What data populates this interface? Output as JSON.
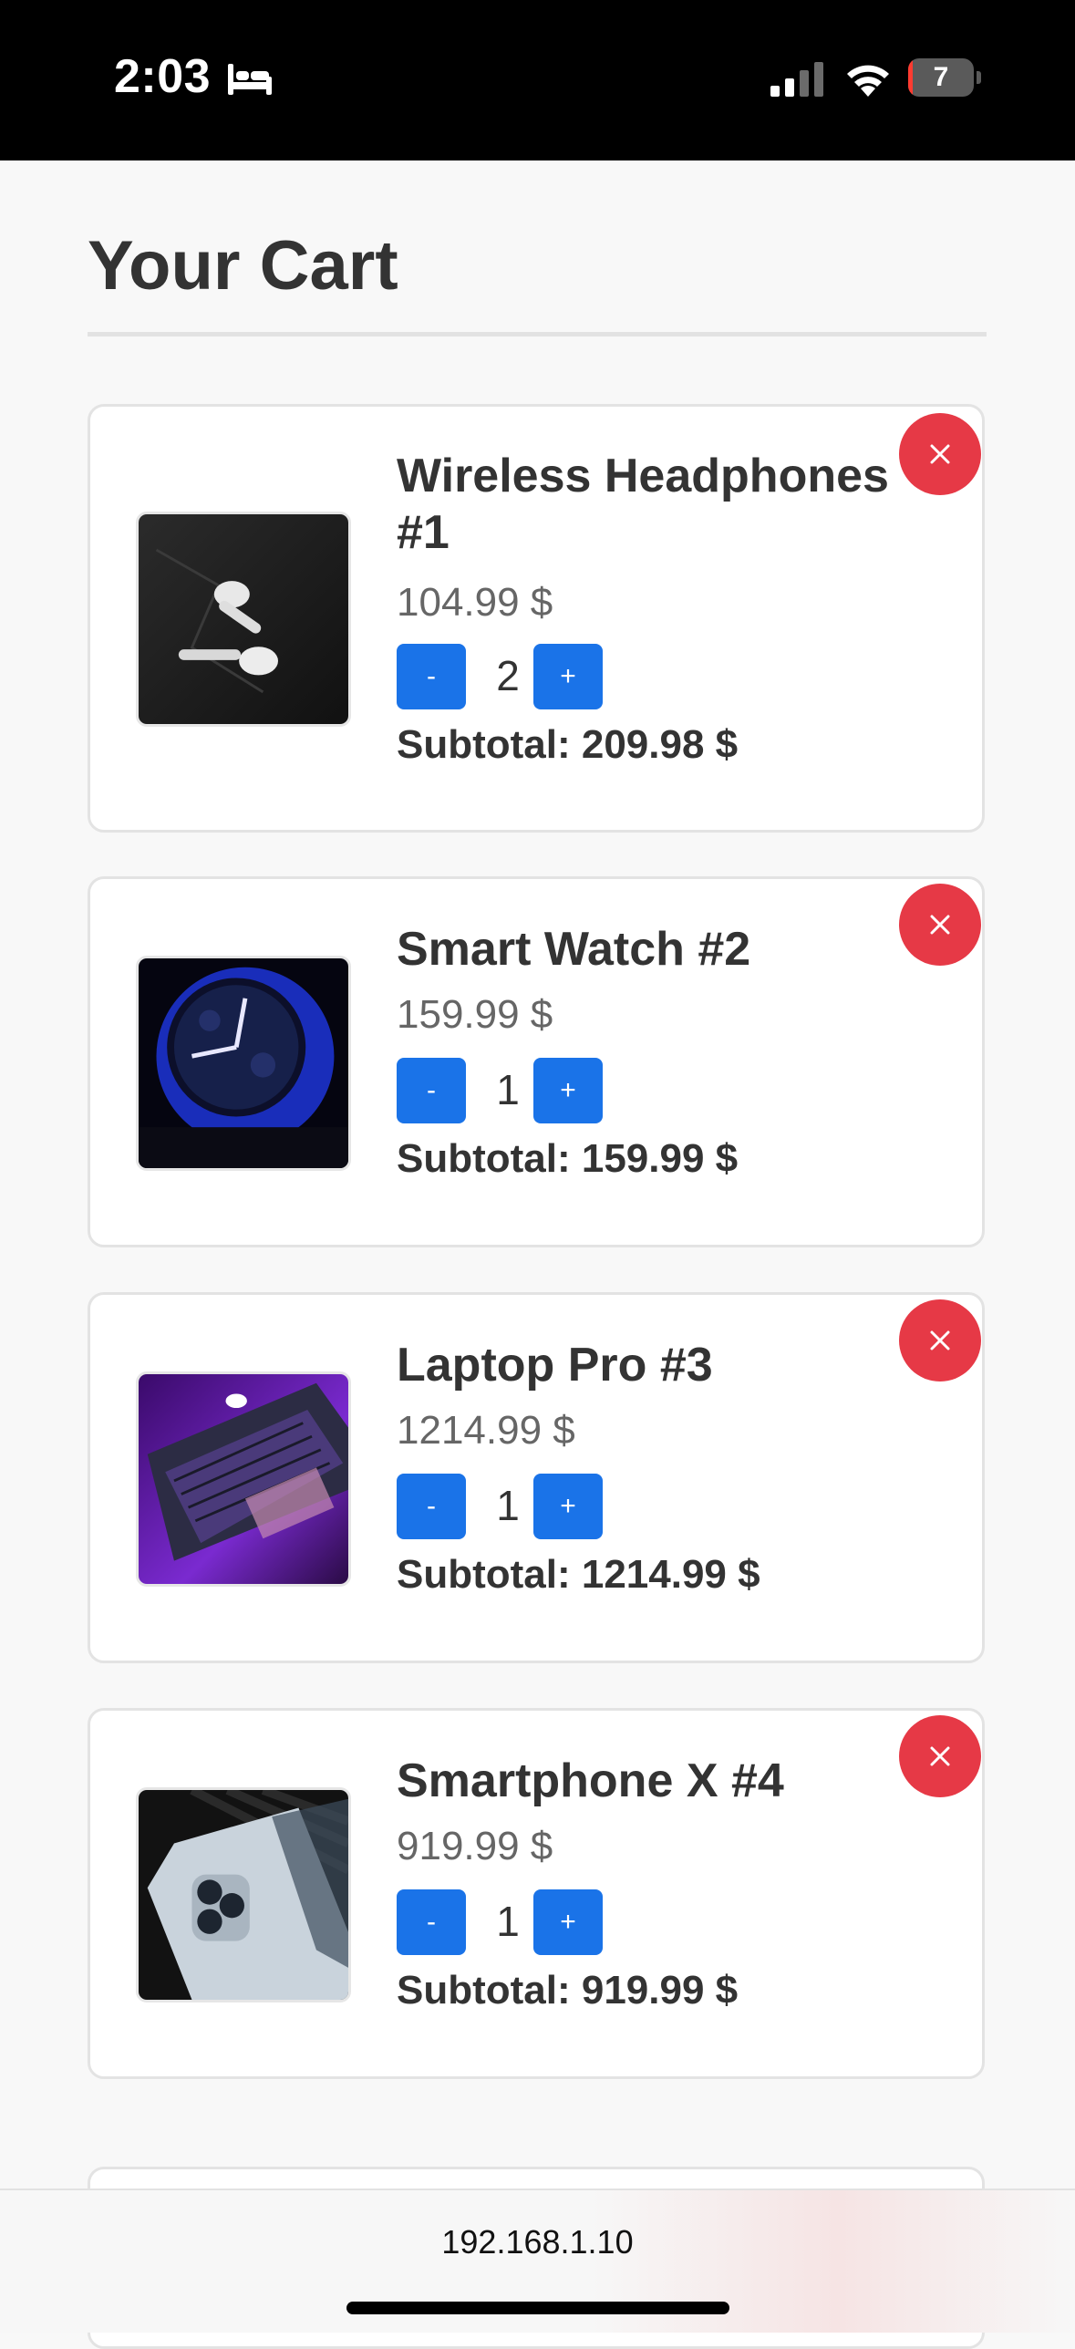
{
  "status_bar": {
    "time": "2:03",
    "focus_icon": "bed-icon",
    "battery_level": "7",
    "battery_fraction": 0.07
  },
  "page": {
    "title": "Your Cart"
  },
  "cart": {
    "items": [
      {
        "name": "Wireless Headphones #1",
        "price": "104.99 $",
        "quantity": "2",
        "subtotal": "Subtotal: 209.98 $",
        "decrement_label": "-",
        "increment_label": "+",
        "image": "wireless-earbuds-photo"
      },
      {
        "name": "Smart Watch #2",
        "price": "159.99 $",
        "quantity": "1",
        "subtotal": "Subtotal: 159.99 $",
        "decrement_label": "-",
        "increment_label": "+",
        "image": "smart-watch-photo"
      },
      {
        "name": "Laptop Pro #3",
        "price": "1214.99 $",
        "quantity": "1",
        "subtotal": "Subtotal: 1214.99 $",
        "decrement_label": "-",
        "increment_label": "+",
        "image": "laptop-photo"
      },
      {
        "name": "Smartphone X #4",
        "price": "919.99 $",
        "quantity": "1",
        "subtotal": "Subtotal: 919.99 $",
        "decrement_label": "-",
        "increment_label": "+",
        "image": "smartphone-photo"
      }
    ]
  },
  "browser": {
    "url": "192.168.1.10"
  },
  "colors": {
    "primary_button": "#1a73e8",
    "remove_button": "#e63946",
    "battery_low": "#ff3b30"
  }
}
